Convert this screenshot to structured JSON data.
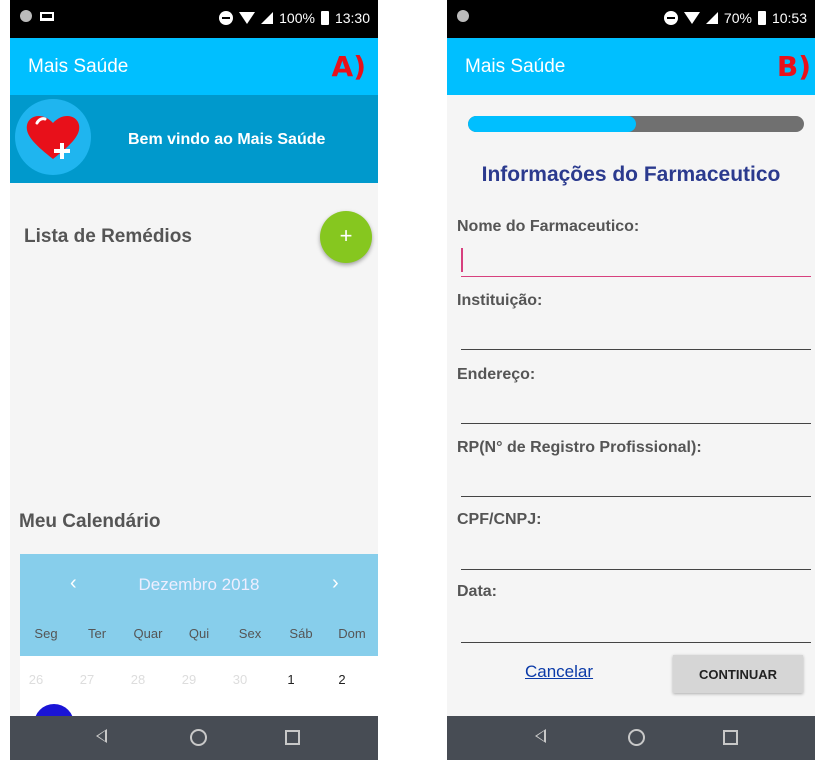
{
  "phoneA": {
    "panel_label": "A)",
    "status": {
      "battery": "100%",
      "time": "13:30"
    },
    "app_title": "Mais Saúde",
    "welcome_text": "Bem vindo ao Mais Saúde",
    "list_title": "Lista de Remédios",
    "add_button": "+",
    "calendar_title": "Meu Calendário",
    "calendar": {
      "prev": "‹",
      "next": "›",
      "month": "Dezembro",
      "year": "2018",
      "weekdays": [
        "Seg",
        "Ter",
        "Quar",
        "Qui",
        "Sex",
        "Sáb",
        "Dom"
      ],
      "days": [
        "26",
        "27",
        "28",
        "29",
        "30",
        "1",
        "2"
      ]
    }
  },
  "phoneB": {
    "panel_label": "B)",
    "status": {
      "battery": "70%",
      "time": "10:53"
    },
    "app_title": "Mais Saúde",
    "progress": 0.5,
    "form_title": "Informações do Farmaceutico",
    "fields": [
      {
        "label": "Nome do Farmaceutico:",
        "value": ""
      },
      {
        "label": "Instituição:",
        "value": ""
      },
      {
        "label": "Endereço:",
        "value": ""
      },
      {
        "label": "RP(N° de Registro Profissional):",
        "value": ""
      },
      {
        "label": "CPF/CNPJ:",
        "value": ""
      },
      {
        "label": "Data:",
        "value": ""
      }
    ],
    "cancel_label": "Cancelar",
    "continue_label": "CONTINUAR"
  },
  "colors": {
    "appbar": "#00bfff",
    "welcome_banner": "#0099cc",
    "fab": "#86c71f",
    "calendar_header": "#87ceeb",
    "form_title": "#2b3a8e",
    "focused_underline": "#d7407e",
    "panel_label": "#e8101a",
    "navbar": "#474c54"
  },
  "icons": [
    "heart-plus-icon",
    "back-nav-icon",
    "home-nav-icon",
    "recents-nav-icon",
    "wifi-icon",
    "signal-icon",
    "battery-icon"
  ]
}
